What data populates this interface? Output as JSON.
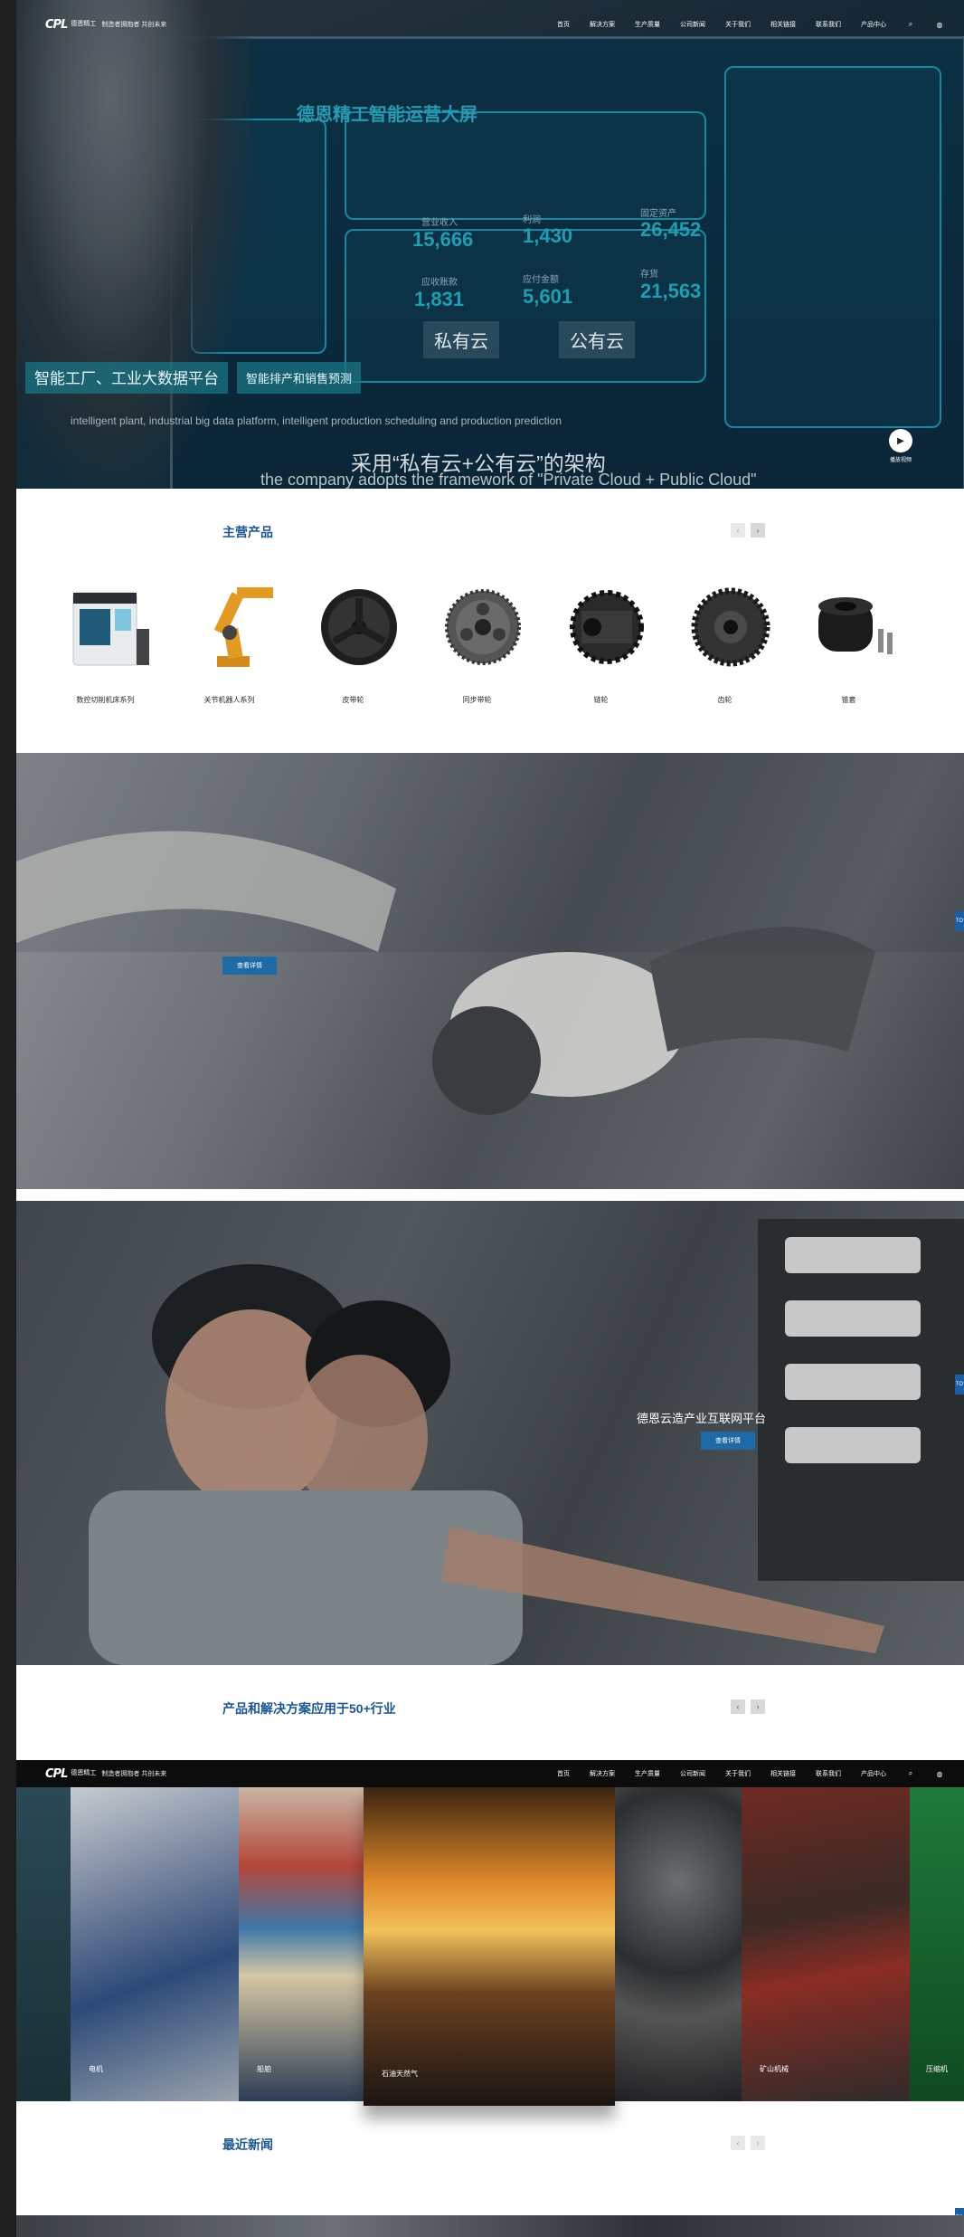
{
  "nav": {
    "logo_mark": "CPL",
    "logo_cn": "德恩精工",
    "slogan": "制造者拥抱者 共创未来",
    "menu": [
      "首页",
      "解决方案",
      "生产质量",
      "公司新闻",
      "关于我们",
      "相关链接",
      "联系我们",
      "产品中心"
    ]
  },
  "hero": {
    "screen_title": "德恩精工智能运营大屏",
    "kpis": [
      {
        "label": "营业收入",
        "value": "15,666"
      },
      {
        "label": "利润",
        "value": "1,430"
      },
      {
        "label": "固定资产",
        "value": "26,452"
      },
      {
        "label": "应收账款",
        "value": "1,831"
      },
      {
        "label": "应付金额",
        "value": "5,601"
      },
      {
        "label": "存货",
        "value": "21,563"
      }
    ],
    "tag_main": "智能工厂、工业大数据平台",
    "tag_side": "智能排产和销售预测",
    "subtitle_en": "intelligent plant, industrial big data platform, intelligent production scheduling and production prediction",
    "cloud_private": "私有云",
    "cloud_public": "公有云",
    "caption": "采用“私有云+公有云”的架构",
    "caption_en": "the company adopts the framework of \"Private Cloud + Public Cloud\"",
    "play_label": "播放视频"
  },
  "products": {
    "title": "主营产品",
    "items": [
      {
        "name": "数控切削机床系列"
      },
      {
        "name": "关节机器人系列"
      },
      {
        "name": "皮带轮"
      },
      {
        "name": "同步带轮"
      },
      {
        "name": "链轮"
      },
      {
        "name": "齿轮"
      },
      {
        "name": "锥套"
      }
    ]
  },
  "banner1": {
    "button": "查看详情",
    "side_tab": "TO"
  },
  "banner2": {
    "title": "德恩云造产业互联网平台",
    "button": "查看详情",
    "side_tab": "TO"
  },
  "industries": {
    "title": "产品和解决方案应用于50+行业",
    "items": [
      {
        "name": "",
        "color": "#1f3a44"
      },
      {
        "name": "电机",
        "color": "#2c4a78"
      },
      {
        "name": "船舶",
        "color": "#b4473a"
      },
      {
        "name": "石油天然气",
        "color": "#e08a2a"
      },
      {
        "name": "",
        "color": "#3b3d40"
      },
      {
        "name": "矿山机械",
        "color": "#8a2d24"
      },
      {
        "name": "压缩机",
        "color": "#1f7a3a"
      }
    ]
  },
  "news": {
    "title": "最近新闻",
    "side_tab": "TO"
  },
  "arrows": {
    "prev": "‹",
    "next": "›"
  }
}
